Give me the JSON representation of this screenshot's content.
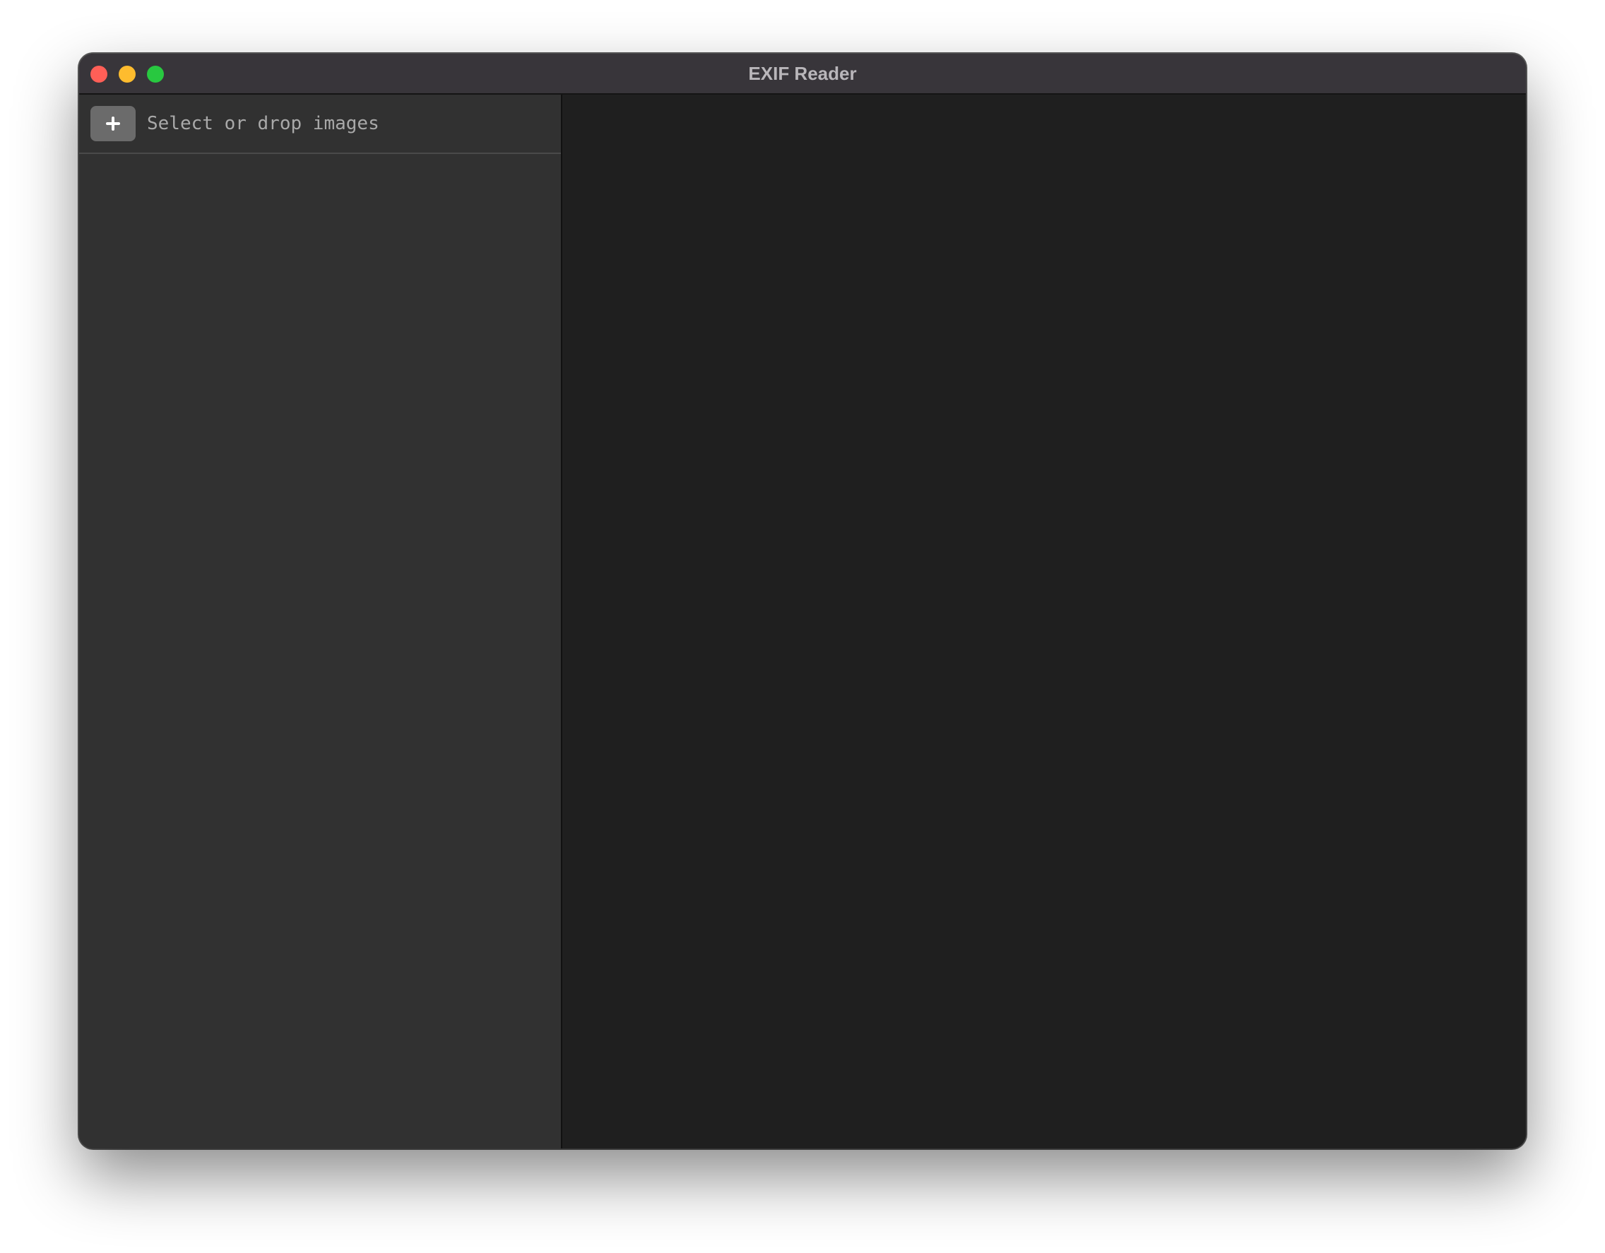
{
  "window": {
    "title": "EXIF Reader"
  },
  "sidebar": {
    "add_button_icon": "plus-icon",
    "drop_label": "Select or drop images",
    "files": []
  },
  "colors": {
    "titlebar": "#38353a",
    "sidebar": "#313131",
    "detail": "#1f1f1f",
    "close": "#ff5f57",
    "minimize": "#febc2e",
    "zoom": "#28c840"
  }
}
